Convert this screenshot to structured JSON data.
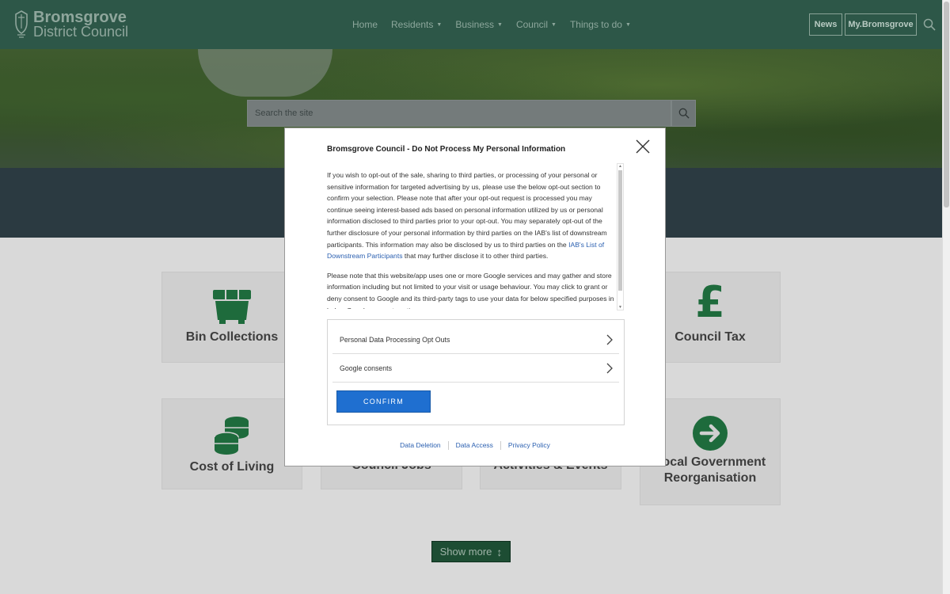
{
  "header": {
    "logo_line1": "Bromsgrove",
    "logo_line2": "District Council",
    "nav": [
      {
        "label": "Home",
        "dropdown": false
      },
      {
        "label": "Residents",
        "dropdown": true
      },
      {
        "label": "Business",
        "dropdown": true
      },
      {
        "label": "Council",
        "dropdown": true
      },
      {
        "label": "Things to do",
        "dropdown": true
      }
    ],
    "news_label": "News",
    "my_label": "My.Bromsgrove",
    "search_icon": "search-icon"
  },
  "hero": {
    "search_placeholder": "Search the site"
  },
  "tiles": [
    {
      "label": "Bin Collections",
      "icon": "bin-icon"
    },
    {
      "label": "Council Tax",
      "icon": "pound-icon"
    },
    {
      "label": "Cost of Living",
      "icon": "coins-icon"
    },
    {
      "label": "Council Jobs",
      "icon": ""
    },
    {
      "label": "Activities & Events",
      "icon": ""
    },
    {
      "label": "Local Government Reorganisation",
      "label_line1": "Local Government",
      "label_line2": "Reorganisation",
      "icon": "arrow-right-circle-icon"
    }
  ],
  "show_more_label": "Show more",
  "modal": {
    "title": "Bromsgrove Council - Do Not Process My Personal Information",
    "para1_text": "If you wish to opt-out of the sale, sharing to third parties, or processing of your personal or sensitive information for targeted advertising by us, please use the below opt-out section to confirm your selection. Please note that after your opt-out request is processed you may continue seeing interest-based ads based on personal information utilized by us or personal information disclosed to third parties prior to your opt-out. You may separately opt-out of the further disclosure of your personal information by third parties on the IAB's list of downstream participants. This information may also be disclosed by us to third parties on the",
    "para1_link": "IAB's List of Downstream Participants",
    "para1_tail": "that may further disclose it to other third parties.",
    "para2_text": "Please note that this website/app uses one or more Google services and may gather and store information including but not limited to your visit or usage behaviour. You may click to grant or deny consent to Google and its third-party tags to use your data for below specified purposes in below Google consent section.",
    "options": [
      {
        "label": "Personal Data Processing Opt Outs"
      },
      {
        "label": "Google consents"
      }
    ],
    "confirm_label": "CONFIRM",
    "footer_links": [
      "Data Deletion",
      "Data Access",
      "Privacy Policy"
    ]
  },
  "colors": {
    "header_bg": "#2d5748",
    "tile_icon_green": "#1e6b3c",
    "confirm_blue": "#1f6fd0",
    "link_blue": "#2a5fb0"
  }
}
